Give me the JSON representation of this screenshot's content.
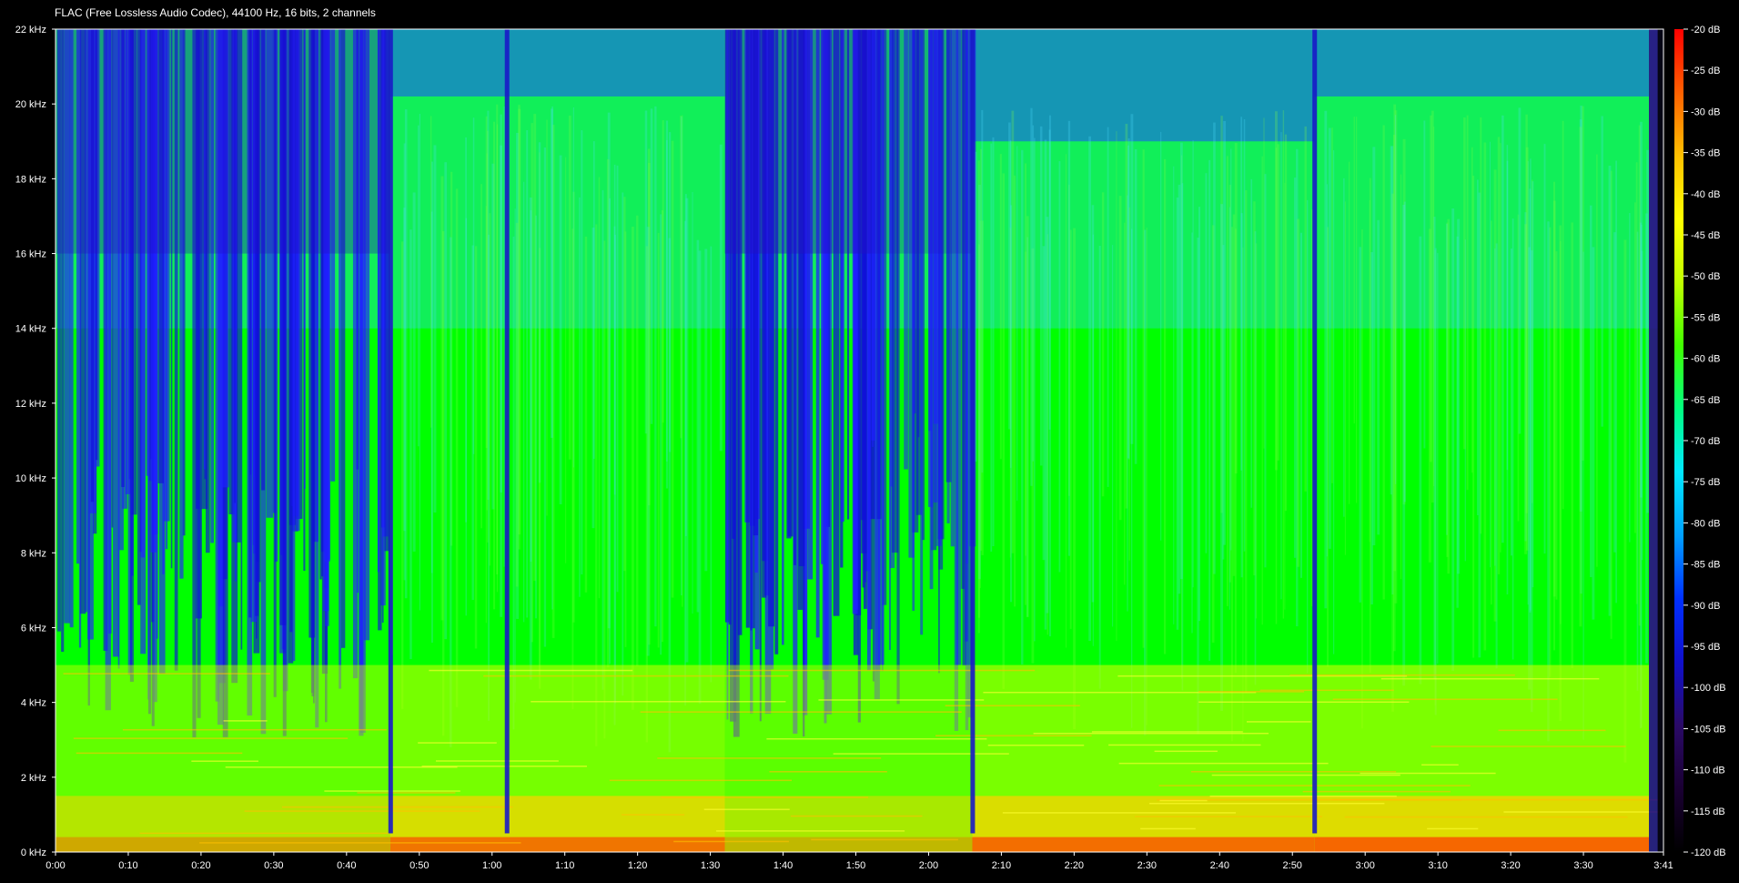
{
  "header": {
    "file_info": "FLAC (Free Lossless Audio Codec), 44100 Hz, 16 bits, 2 channels"
  },
  "colors": {
    "background": "#000000",
    "axis_text": "#ffffff",
    "colormap": [
      "#000000",
      "#1a0033",
      "#2a0a66",
      "#1010cc",
      "#0030ff",
      "#00a0ff",
      "#00e8ff",
      "#00ff80",
      "#40ff00",
      "#c0ff00",
      "#ffff00",
      "#ffc000",
      "#ff6000",
      "#ff0000"
    ]
  },
  "chart_data": {
    "type": "heatmap",
    "title": "",
    "xlabel": "",
    "ylabel": "",
    "x_unit": "time (m:ss)",
    "y_unit": "kHz",
    "duration_label": "3:41",
    "xlim": [
      "0:00",
      "3:41"
    ],
    "ylim_khz": [
      0,
      22
    ],
    "zlim_db": [
      -120,
      -20
    ],
    "x_ticks": [
      "0:00",
      "0:10",
      "0:20",
      "0:30",
      "0:40",
      "0:50",
      "1:00",
      "1:10",
      "1:20",
      "1:30",
      "1:40",
      "1:50",
      "2:00",
      "2:10",
      "2:20",
      "2:30",
      "2:40",
      "2:50",
      "3:00",
      "3:10",
      "3:20",
      "3:30",
      "3:41"
    ],
    "y_ticks": [
      "0 kHz",
      "2 kHz",
      "4 kHz",
      "6 kHz",
      "8 kHz",
      "10 kHz",
      "12 kHz",
      "14 kHz",
      "16 kHz",
      "18 kHz",
      "20 kHz",
      "22 kHz"
    ],
    "colorbar_ticks": [
      "-20 dB",
      "-25 dB",
      "-30 dB",
      "-35 dB",
      "-40 dB",
      "-45 dB",
      "-50 dB",
      "-55 dB",
      "-60 dB",
      "-65 dB",
      "-70 dB",
      "-75 dB",
      "-80 dB",
      "-85 dB",
      "-90 dB",
      "-95 dB",
      "-100 dB",
      "-105 dB",
      "-110 dB",
      "-115 dB",
      "-120 dB"
    ],
    "sections": [
      {
        "start": "0:00",
        "end": "0:46",
        "character": "quiet, sparse high frequencies"
      },
      {
        "start": "0:46",
        "end": "1:32",
        "character": "loud, full band to ~20 kHz"
      },
      {
        "start": "1:32",
        "end": "1:52",
        "character": "quiet, strongly attenuated above ~6 kHz"
      },
      {
        "start": "1:52",
        "end": "2:06",
        "character": "moderate"
      },
      {
        "start": "2:06",
        "end": "2:53",
        "character": "loud, full band to ~19 kHz"
      },
      {
        "start": "2:53",
        "end": "3:39",
        "character": "loud, full band to ~20 kHz"
      },
      {
        "start": "3:39",
        "end": "3:41",
        "character": "fade out"
      }
    ],
    "gaps": [
      "0:46",
      "1:02",
      "2:06",
      "2:53"
    ]
  }
}
